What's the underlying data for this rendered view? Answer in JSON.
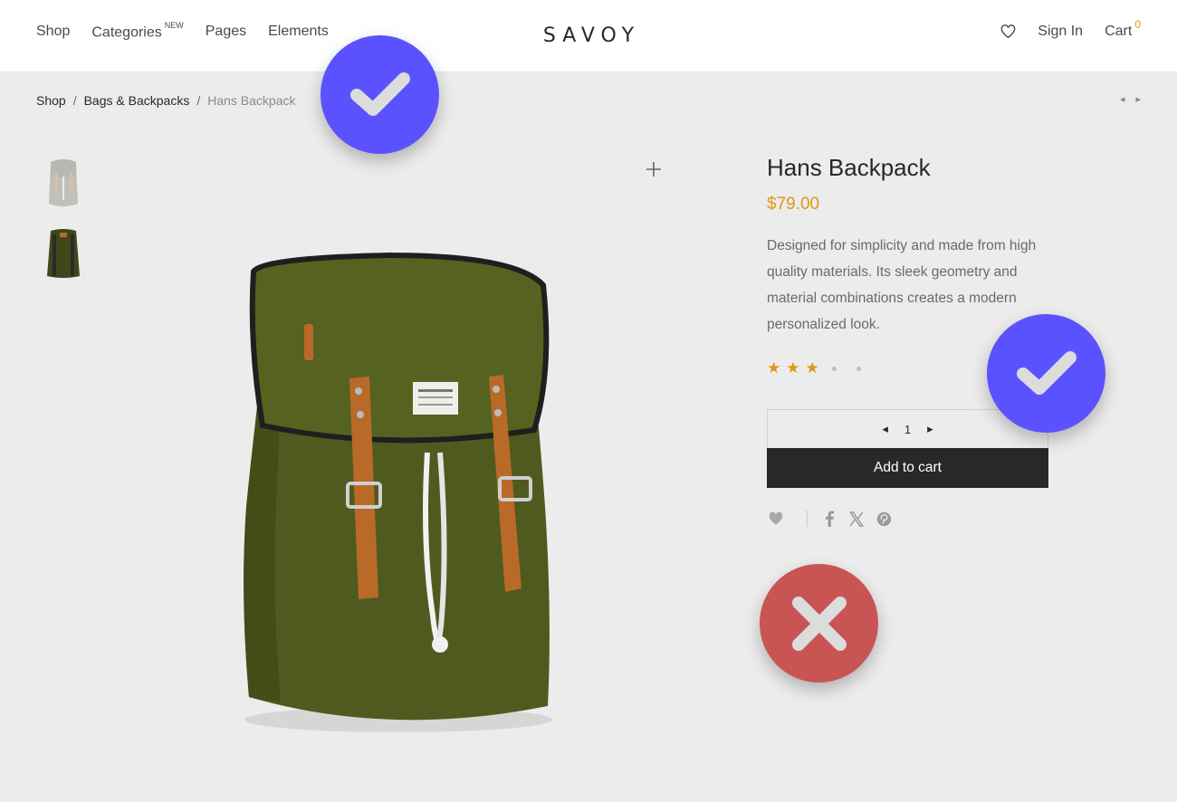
{
  "header": {
    "nav": [
      {
        "label": "Shop"
      },
      {
        "label": "Categories",
        "badge": "NEW"
      },
      {
        "label": "Pages"
      },
      {
        "label": "Elements"
      }
    ],
    "logo": "SAVOY",
    "sign_in": "Sign In",
    "cart_label": "Cart",
    "cart_count": "0"
  },
  "breadcrumb": {
    "items": [
      "Shop",
      "Bags & Backpacks"
    ],
    "separator": "/",
    "current": "Hans Backpack"
  },
  "product_nav": {
    "prev": "◂",
    "next": "▸"
  },
  "product": {
    "title": "Hans Backpack",
    "price": "$79.00",
    "description": "Designed for simplicity and made from high quality materials. Its sleek geometry and material combinations creates a modern personalized look.",
    "rating": 3,
    "rating_max": 5,
    "quantity": "1",
    "qty_minus": "◂",
    "qty_plus": "▸",
    "add_to_cart": "Add to cart"
  },
  "colors": {
    "accent": "#dc9814",
    "button_bg": "#282828",
    "badge_check": "#5b52ff",
    "badge_cross": "#c95454",
    "backpack": "#4f5a1f",
    "leather": "#b96a28"
  },
  "icons": [
    "heart-icon",
    "plus-icon",
    "facebook-icon",
    "x-icon",
    "pinterest-icon",
    "checkmark-icon",
    "cross-icon"
  ]
}
